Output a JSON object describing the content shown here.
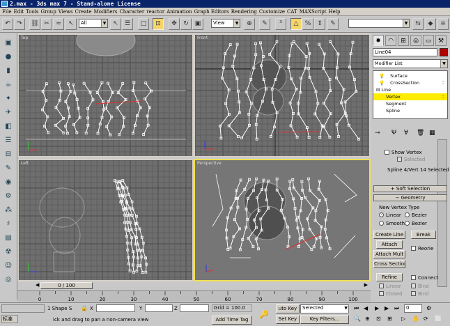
{
  "window": {
    "title": "2.max - 3ds max 7  - Stand-alone License"
  },
  "menu": [
    "File",
    "Edit",
    "Tools",
    "Group",
    "Views",
    "Create",
    "Modifiers",
    "Character",
    "reactor",
    "Animation",
    "Graph Editors",
    "Rendering",
    "Customize",
    "CAT",
    "MAXScript",
    "Help"
  ],
  "toolbar": {
    "selection_filter": "All",
    "ref_coord": "View",
    "named_selection": ""
  },
  "viewports": {
    "top": "Top",
    "front": "Front",
    "left": "Left",
    "perspective": "Perspective"
  },
  "command_panel": {
    "object_name": "Line04",
    "object_color": "#b00000",
    "modifier_list": "Modifier List",
    "stack": [
      "Surface",
      "CrossSection",
      "Line",
      "Vertex",
      "Segment",
      "Spline"
    ],
    "selection": {
      "show_vertex": "Show Vertex",
      "selected": "Selected",
      "info": "Spline 4/Vert 14 Selected"
    },
    "soft_selection": "Soft Selection",
    "geometry": "Geometry",
    "new_vertex_type": "New Vertex Type",
    "linear": "Linear",
    "bezier": "Bezier",
    "smooth": "Smooth",
    "bezier_corner": "Bezier",
    "create_line": "Create Line",
    "break": "Break",
    "attach": "Attach",
    "reorient": "Reorie",
    "attach_mult": "Attach Mult",
    "cross_section": "Cross Section",
    "refine": "Refine",
    "connect": "Connect",
    "linear2": "Linear",
    "bind_first": "Bind",
    "closed": "Closed",
    "bind_last": "Bind"
  },
  "timeline": {
    "frame": "0 / 100",
    "ticks": [
      "0",
      "10",
      "20",
      "30",
      "40",
      "50",
      "60",
      "70",
      "80",
      "90",
      "100"
    ]
  },
  "status": {
    "selected": "1 Shape S",
    "x_label": "X",
    "y_label": "Y",
    "z_label": "Z",
    "grid": "Grid = 100.0",
    "auto_key": "uto Key",
    "selected_dropdown": "Selected",
    "set_key": "Set Key",
    "key_filters": "Key Filters...",
    "prompt": "ick and drag to pan a non-camera view",
    "add_time_tag": "Add Time Tag",
    "lang": "标准",
    "frame_spin": "0"
  }
}
